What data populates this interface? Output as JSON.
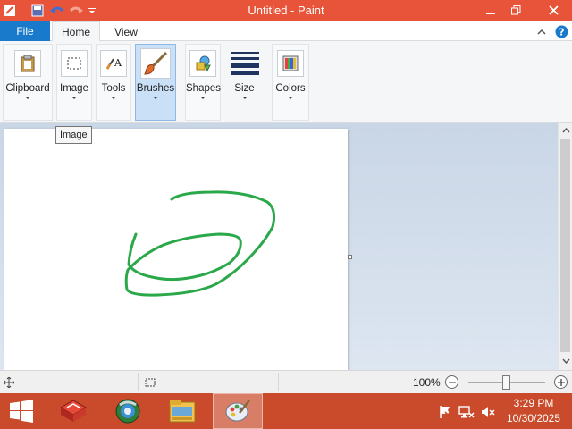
{
  "window": {
    "title": "Untitled - Paint",
    "controls": [
      "minimize-icon",
      "restore-icon",
      "close-icon"
    ]
  },
  "quick_access": [
    "save-icon",
    "undo-icon",
    "redo-icon",
    "customize-dropdown-icon"
  ],
  "ribbon": {
    "tabs": [
      {
        "label": "File"
      },
      {
        "label": "Home",
        "selected": true
      },
      {
        "label": "View"
      }
    ],
    "groups": [
      {
        "label": "Clipboard",
        "icon": "clipboard-icon"
      },
      {
        "label": "Image",
        "icon": "select-rectangle-icon"
      },
      {
        "label": "Tools",
        "icon": "text-tool-icon"
      },
      {
        "label": "Brushes",
        "icon": "brush-icon",
        "active": true
      },
      {
        "label": "Shapes",
        "icon": "shapes-icon"
      },
      {
        "label": "Size",
        "icon": "line-size-icon"
      },
      {
        "label": "Colors",
        "icon": "color-palette-icon"
      }
    ]
  },
  "tooltip": {
    "text": "Image"
  },
  "canvas": {
    "stroke_color": "#2aa84a",
    "drawing": "green-loop-stroke"
  },
  "status": {
    "zoom": "100%"
  },
  "taskbar": {
    "apps": [
      "start-icon",
      "app-icon-red",
      "browser-icon",
      "file-explorer-icon",
      "paint-app-icon"
    ],
    "active_app": "paint-app-icon",
    "tray": [
      "flag-icon",
      "network-icon",
      "volume-muted-icon"
    ],
    "time": "3:29 PM",
    "date": "10/30/2025"
  },
  "colors": {
    "titlebar": "#e8543a",
    "file_tab": "#1979ca",
    "taskbar": "#c94b2b"
  }
}
